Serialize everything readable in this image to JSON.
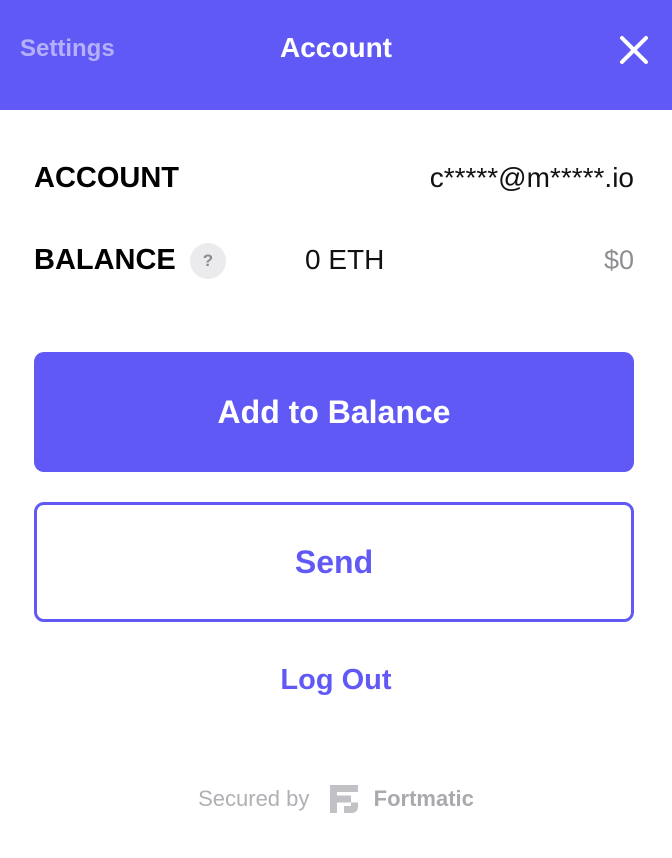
{
  "header": {
    "settings_label": "Settings",
    "title": "Account",
    "close_icon": "close-icon"
  },
  "account": {
    "label": "ACCOUNT",
    "value": "c*****@m*****.io"
  },
  "balance": {
    "label": "BALANCE",
    "help_glyph": "?",
    "eth": "0 ETH",
    "usd": "$0"
  },
  "actions": {
    "add_balance_label": "Add to Balance",
    "send_label": "Send",
    "logout_label": "Log Out"
  },
  "footer": {
    "secured_by": "Secured by",
    "brand": "Fortmatic",
    "brand_icon": "fortmatic-logo-icon"
  },
  "colors": {
    "accent": "#6159f5",
    "muted_text": "#8e8e93",
    "header_secondary": "#b4b0fb"
  }
}
